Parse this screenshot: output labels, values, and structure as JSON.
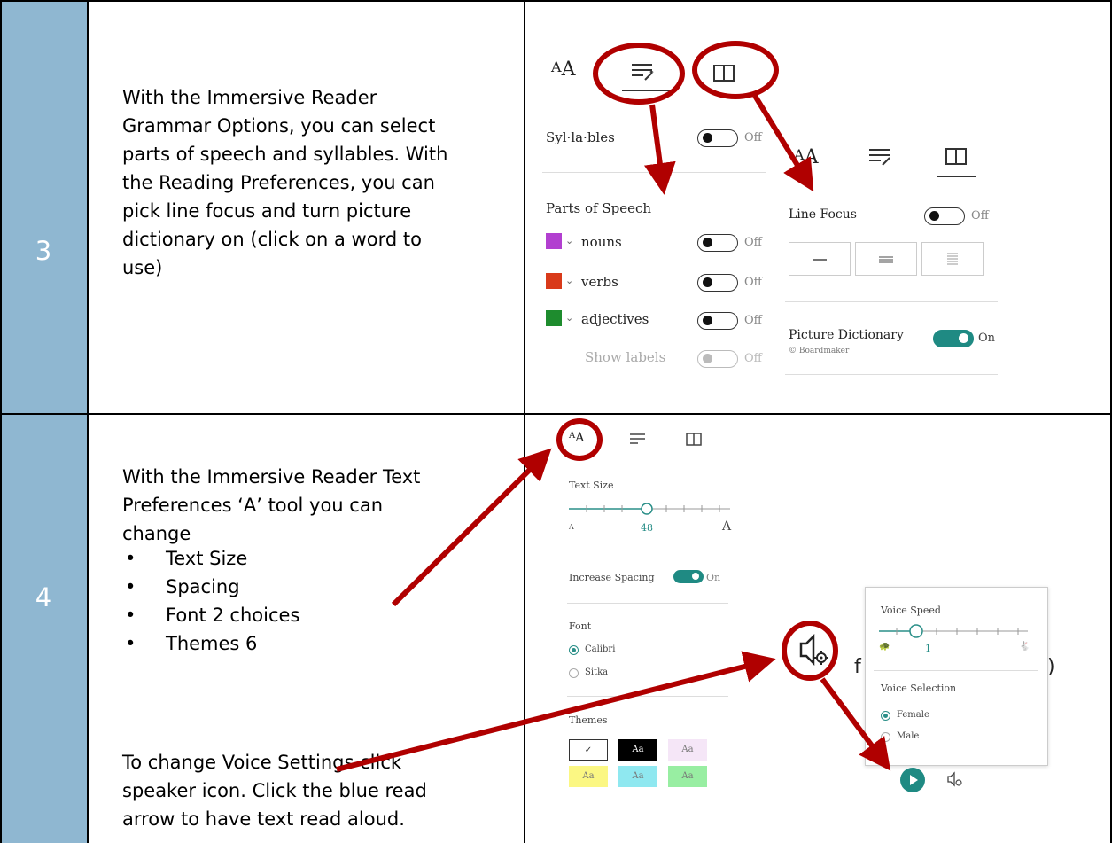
{
  "rows": [
    {
      "number": "3",
      "description_lines": [
        "With the Immersive Reader",
        "Grammar Options, you can select",
        "parts of speech and syllables. With",
        "the Reading Preferences, you can",
        "pick line focus and turn picture",
        "dictionary on (click on a word to",
        "use)"
      ]
    },
    {
      "number": "4",
      "intro_lines": [
        "With the Immersive Reader Text",
        "Preferences ‘A’ tool you can",
        "change"
      ],
      "bullets": [
        "Text Size",
        "Spacing",
        "Font 2 choices",
        "Themes 6"
      ],
      "voice_lines": [
        "To change Voice Settings click",
        "speaker icon. Click the blue read",
        "arrow to have text read aloud."
      ]
    }
  ],
  "grammar_panel": {
    "syllables_label": "Syl·la·bles",
    "syllables_state": "Off",
    "parts_title": "Parts of Speech",
    "items": [
      {
        "label": "nouns",
        "color": "#b23fd0",
        "state": "Off"
      },
      {
        "label": "verbs",
        "color": "#d93a1a",
        "state": "Off"
      },
      {
        "label": "adjectives",
        "color": "#1e8c2e",
        "state": "Off"
      }
    ],
    "show_labels": "Show labels",
    "show_labels_state": "Off"
  },
  "reading_panel": {
    "line_focus_label": "Line Focus",
    "line_focus_state": "Off",
    "picture_dictionary_label": "Picture Dictionary",
    "picture_dictionary_credit": "© Boardmaker",
    "picture_dictionary_state": "On"
  },
  "text_panel": {
    "text_size_label": "Text Size",
    "text_size_value": "48",
    "text_size_min": "A",
    "text_size_max": "A",
    "spacing_label": "Increase Spacing",
    "spacing_state": "On",
    "font_label": "Font",
    "fonts": [
      "Calibri",
      "Sitka"
    ],
    "themes_label": "Themes",
    "themes": [
      "✓",
      "Aa",
      "Aa",
      "Aa",
      "Aa",
      "Aa"
    ]
  },
  "voice_panel": {
    "speed_label": "Voice Speed",
    "speed_value": "1",
    "selection_label": "Voice Selection",
    "voices": [
      "Female",
      "Male"
    ]
  },
  "colors": {
    "number_column": "#8fb7d1",
    "annotation_red": "#b00000",
    "toggle_on": "#1f8a83"
  }
}
